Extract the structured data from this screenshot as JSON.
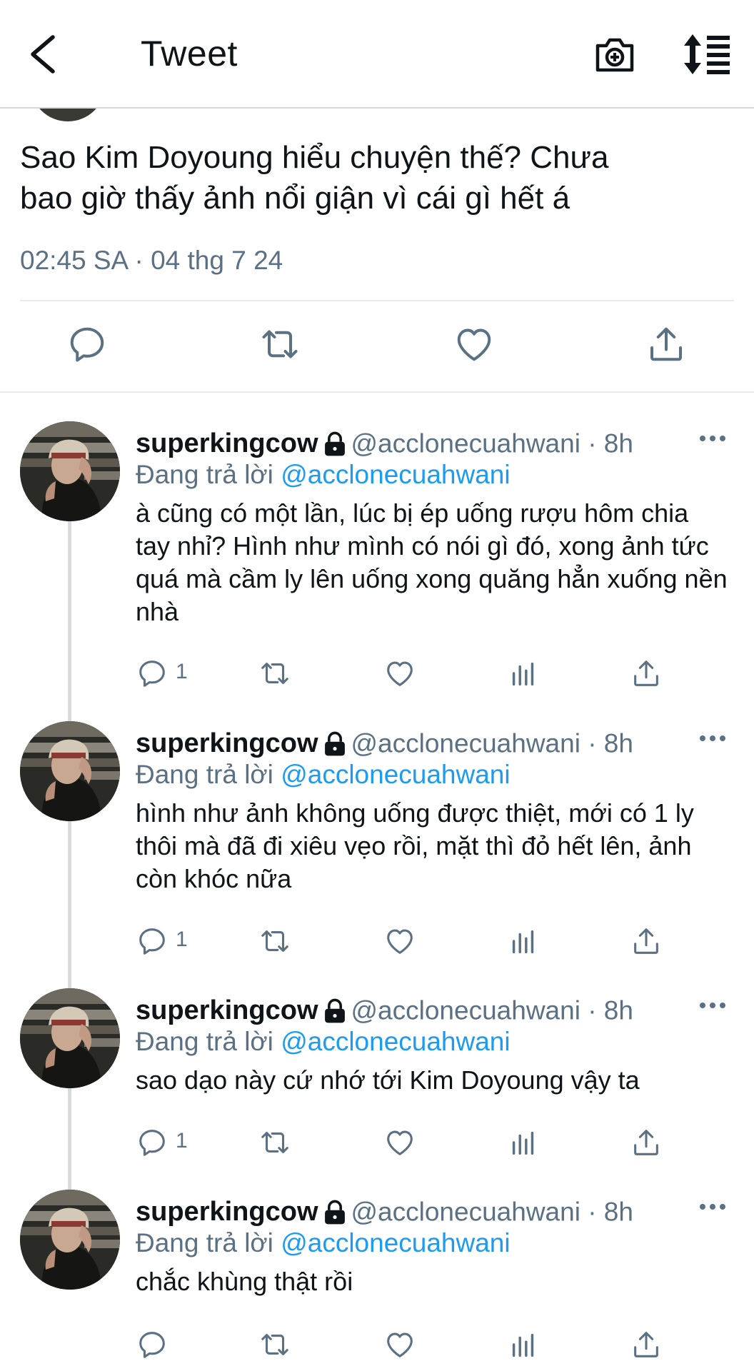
{
  "header": {
    "title": "Tweet"
  },
  "main_tweet": {
    "text_line1": "Sao Kim Doyoung hiểu chuyện thế? Chưa",
    "text_line2": "bao giờ thấy ảnh nổi giận vì cái gì hết á",
    "timestamp": "02:45 SA · 04 thg 7 24"
  },
  "replies": [
    {
      "name": "superkingcow",
      "handle_time": "@acclonecuahwani · 8h",
      "replying_prefix": "Đang trả lời",
      "replying_to": "@acclonecuahwani",
      "text": "à cũng có một lần, lúc bị ép uống rượu hôm chia tay nhỉ? Hình như mình có nói gì đó, xong ảnh tức quá mà cầm ly lên uống xong quăng hẳn xuống nền nhà",
      "reply_count": "1"
    },
    {
      "name": "superkingcow",
      "handle_time": "@acclonecuahwani · 8h",
      "replying_prefix": "Đang trả lời",
      "replying_to": "@acclonecuahwani",
      "text": "hình như ảnh không uống được thiệt, mới có 1 ly thôi mà đã đi xiêu vẹo rồi, mặt thì đỏ hết lên, ảnh còn khóc nữa",
      "reply_count": "1"
    },
    {
      "name": "superkingcow",
      "handle_time": "@acclonecuahwani · 8h",
      "replying_prefix": "Đang trả lời",
      "replying_to": "@acclonecuahwani",
      "text": "sao dạo này cứ nhớ tới Kim Doyoung vậy ta",
      "reply_count": "1"
    },
    {
      "name": "superkingcow",
      "handle_time": "@acclonecuahwani · 8h",
      "replying_prefix": "Đang trả lời",
      "replying_to": "@acclonecuahwani",
      "text": "chắc khùng thật rồi",
      "reply_count": ""
    }
  ],
  "icons": {
    "back": "chevron-left-icon",
    "camera": "camera-plus-icon",
    "sort": "sort-icon",
    "reply": "comment-icon",
    "retweet": "retweet-icon",
    "like": "heart-icon",
    "views": "bar-chart-icon",
    "share": "share-icon",
    "lock": "lock-icon",
    "more": "more-dots-icon"
  },
  "colors": {
    "text": "#0f1419",
    "secondary": "#5b7083",
    "link": "#1d9bf0"
  }
}
